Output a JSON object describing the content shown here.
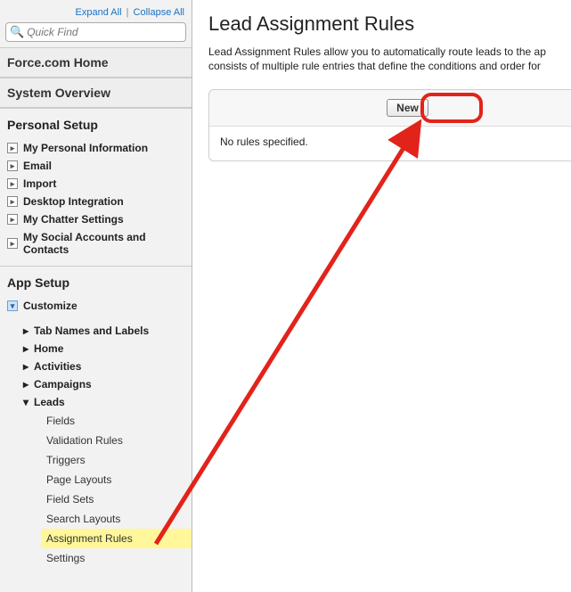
{
  "sidebar": {
    "expand": "Expand All",
    "collapse": "Collapse All",
    "search_placeholder": "Quick Find",
    "home": "Force.com Home",
    "overview": "System Overview",
    "personal_label": "Personal Setup",
    "personal": [
      "My Personal Information",
      "Email",
      "Import",
      "Desktop Integration",
      "My Chatter Settings",
      "My Social Accounts and Contacts"
    ],
    "app_label": "App Setup",
    "customize": "Customize",
    "customize_children": [
      "Tab Names and Labels",
      "Home",
      "Activities",
      "Campaigns"
    ],
    "leads": "Leads",
    "leads_children": [
      "Fields",
      "Validation Rules",
      "Triggers",
      "Page Layouts",
      "Field Sets",
      "Search Layouts",
      "Assignment Rules",
      "Settings"
    ]
  },
  "main": {
    "title": "Lead Assignment Rules",
    "intro": "Lead Assignment Rules allow you to automatically route leads to the ap\nconsists of multiple rule entries that define the conditions and order for ",
    "new_label": "New",
    "empty": "No rules specified."
  }
}
